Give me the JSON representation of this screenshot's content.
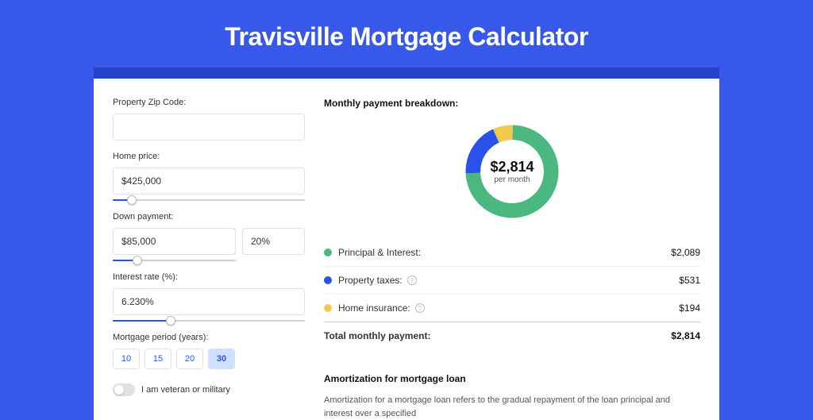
{
  "page": {
    "title": "Travisville Mortgage Calculator"
  },
  "form": {
    "zip": {
      "label": "Property Zip Code:",
      "value": ""
    },
    "home_price": {
      "label": "Home price:",
      "value": "$425,000",
      "slider_pct": 10
    },
    "down_payment": {
      "label": "Down payment:",
      "amount": "$85,000",
      "percent": "20%",
      "slider_pct": 20
    },
    "interest": {
      "label": "Interest rate (%):",
      "value": "6.230%",
      "slider_pct": 30
    },
    "period": {
      "label": "Mortgage period (years):",
      "options": [
        "10",
        "15",
        "20",
        "30"
      ],
      "selected": "30"
    },
    "veteran": {
      "label": "I am veteran or military",
      "on": false
    }
  },
  "breakdown": {
    "title": "Monthly payment breakdown:",
    "center_amount": "$2,814",
    "center_sub": "per month",
    "items": [
      {
        "label": "Principal & Interest:",
        "value": "$2,089",
        "color": "green",
        "info": false
      },
      {
        "label": "Property taxes:",
        "value": "$531",
        "color": "blue",
        "info": true
      },
      {
        "label": "Home insurance:",
        "value": "$194",
        "color": "yellow",
        "info": true
      }
    ],
    "total": {
      "label": "Total monthly payment:",
      "value": "$2,814"
    }
  },
  "amort": {
    "title": "Amortization for mortgage loan",
    "text": "Amortization for a mortgage loan refers to the gradual repayment of the loan principal and interest over a specified"
  },
  "chart_data": {
    "type": "pie",
    "title": "Monthly payment breakdown",
    "series": [
      {
        "name": "Principal & Interest",
        "value": 2089,
        "color": "#4bb97f"
      },
      {
        "name": "Property taxes",
        "value": 531,
        "color": "#2953e8"
      },
      {
        "name": "Home insurance",
        "value": 194,
        "color": "#f3c94b"
      }
    ],
    "total": 2814
  }
}
